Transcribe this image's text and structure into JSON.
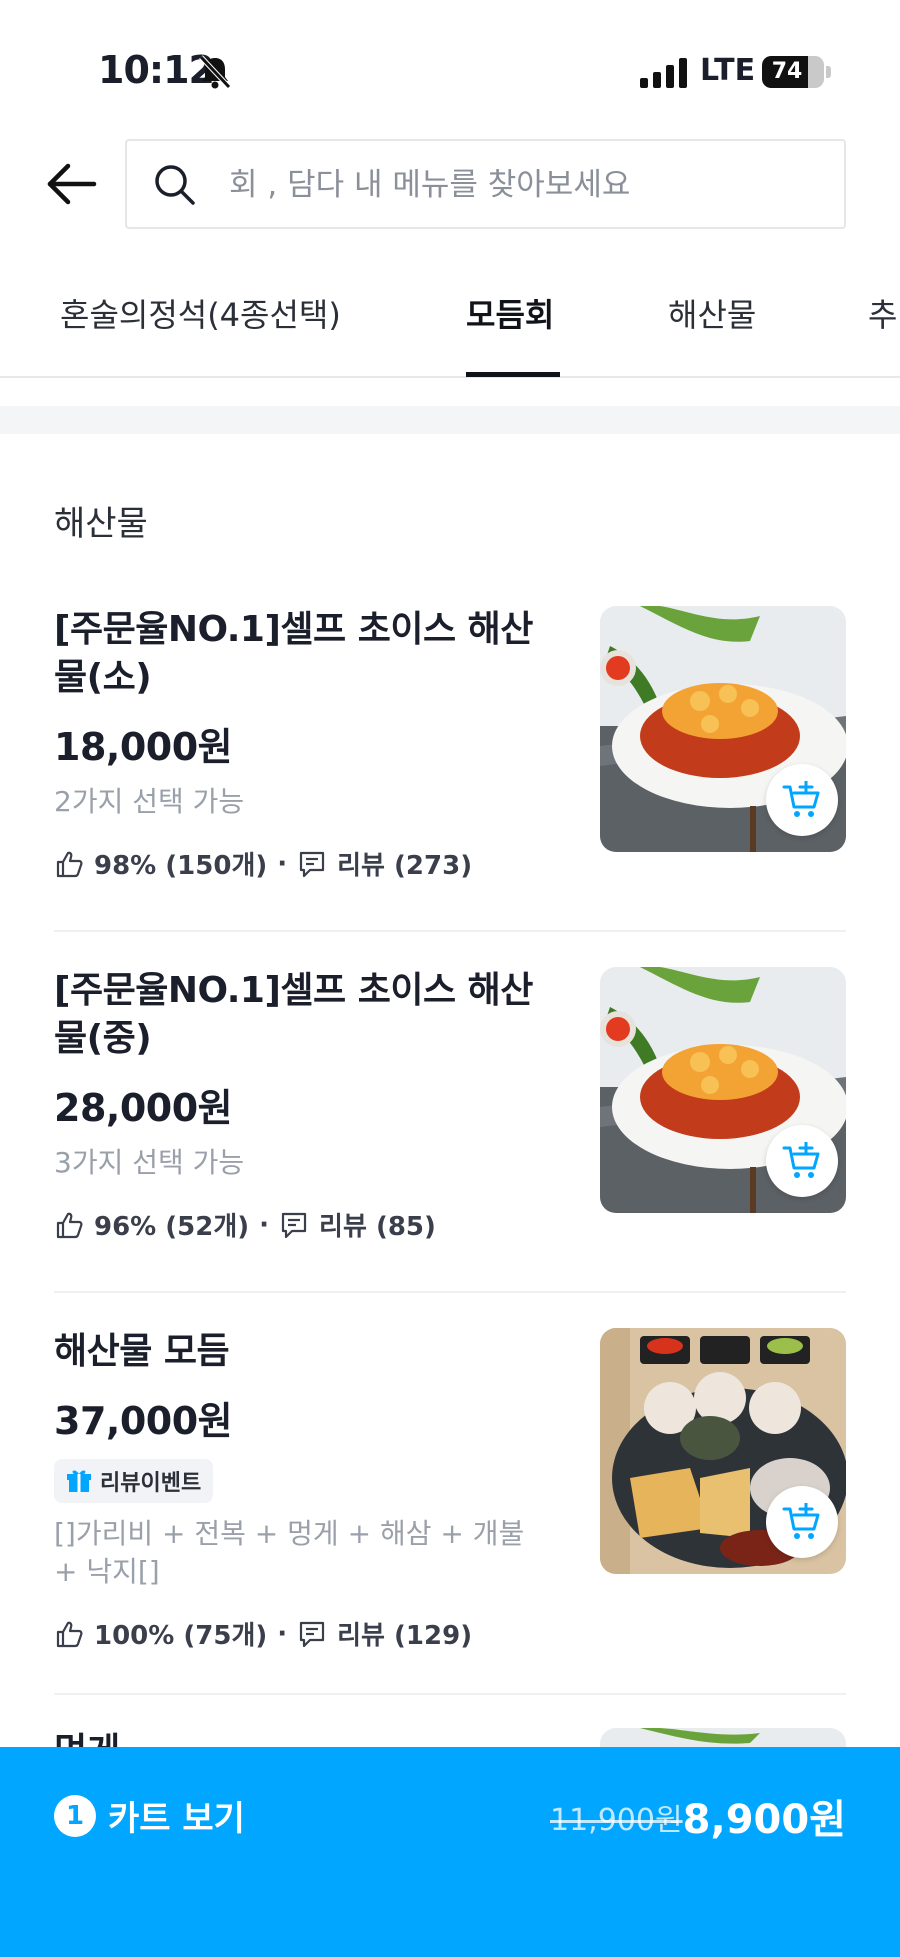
{
  "status_bar": {
    "time": "10:12",
    "network": "LTE",
    "battery": "74",
    "battery_level": 0.74
  },
  "search": {
    "placeholder": "회 , 담다 내 메뉴를 찾아보세요",
    "value": ""
  },
  "tabs": [
    {
      "label": "혼술의정석(4종선택)",
      "active": false
    },
    {
      "label": "모듬회",
      "active": true
    },
    {
      "label": "해산물",
      "active": false
    },
    {
      "label": "추",
      "active": false
    }
  ],
  "section": {
    "title": "해산물"
  },
  "menu_items": [
    {
      "name": "[주문율NO.1]셀프 초이스 해산물(소)",
      "price": "18,000원",
      "desc": "2가지 선택 가능",
      "like_rate": "98% (150개)",
      "review": "리뷰 (273)"
    },
    {
      "name": "[주문율NO.1]셀프 초이스 해산물(중)",
      "price": "28,000원",
      "desc": "3가지 선택 가능",
      "like_rate": "96% (52개)",
      "review": "리뷰 (85)"
    },
    {
      "name": "해산물 모듬",
      "price": "37,000원",
      "badge": "리뷰이벤트",
      "desc": "[]가리비 + 전복 + 멍게 + 해삼 + 개불 + 낙지[]",
      "like_rate": "100% (75개)",
      "review": "리뷰 (129)"
    },
    {
      "name": "멍게"
    }
  ],
  "cart": {
    "count": "1",
    "label": "카트 보기",
    "original_price": "11,900원",
    "total_price": "8,900원"
  },
  "colors": {
    "accent": "#00a6ff",
    "text": "#1b1f2b",
    "muted": "#9aa0aa"
  }
}
